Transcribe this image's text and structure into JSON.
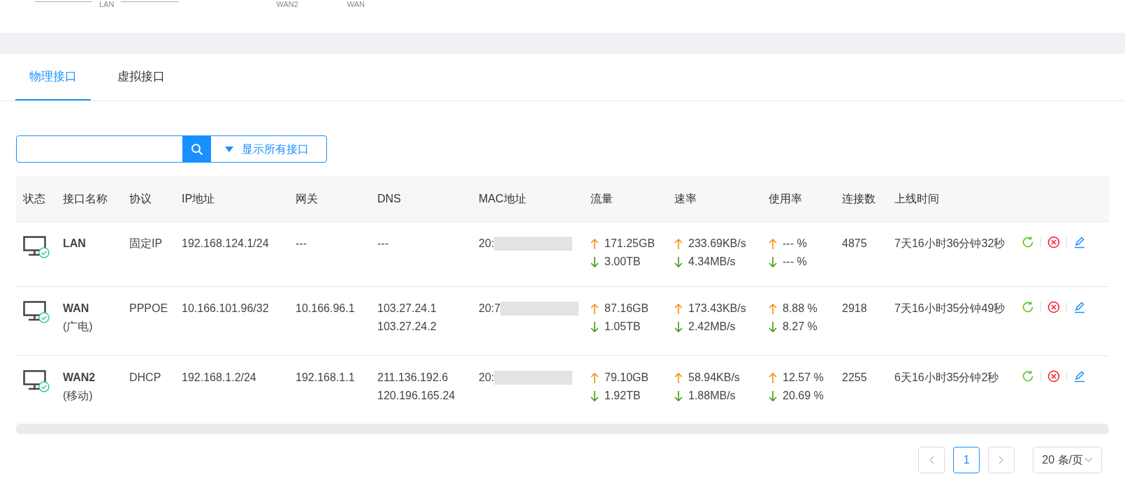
{
  "topology_labels": [
    "LAN",
    "WAN2",
    "WAN"
  ],
  "tabs": [
    {
      "label": "物理接口",
      "selected": true
    },
    {
      "label": "虚拟接口",
      "selected": false
    }
  ],
  "search": {
    "filter_label": "显示所有接口"
  },
  "table": {
    "columns": [
      "状态",
      "接口名称",
      "协议",
      "IP地址",
      "网关",
      "DNS",
      "MAC地址",
      "流量",
      "速率",
      "使用率",
      "连接数",
      "上线时间"
    ],
    "rows": [
      {
        "online": true,
        "name": "LAN",
        "isp": null,
        "protocol": "固定IP",
        "ip": "192.168.124.1/24",
        "gateway": "---",
        "dns": [
          "---"
        ],
        "mac": "20:",
        "traffic": [
          "171.25GB",
          "3.00TB"
        ],
        "rate": [
          "233.69KB/s",
          "4.34MB/s"
        ],
        "usage": [
          "--- %",
          "--- %"
        ],
        "connections": "4875",
        "uptime": "7天16小时36分钟32秒"
      },
      {
        "online": true,
        "name": "WAN",
        "isp": "(广电)",
        "protocol": "PPPOE",
        "ip": "10.166.101.96/32",
        "gateway": "10.166.96.1",
        "dns": [
          "103.27.24.1",
          "103.27.24.2"
        ],
        "mac": "20:7",
        "traffic": [
          "87.16GB",
          "1.05TB"
        ],
        "rate": [
          "173.43KB/s",
          "2.42MB/s"
        ],
        "usage": [
          "8.88 %",
          "8.27 %"
        ],
        "connections": "2918",
        "uptime": "7天16小时35分钟49秒"
      },
      {
        "online": true,
        "name": "WAN2",
        "isp": "(移动)",
        "protocol": "DHCP",
        "ip": "192.168.1.2/24",
        "gateway": "192.168.1.1",
        "dns": [
          "211.136.192.6",
          "120.196.165.24"
        ],
        "mac": "20:",
        "traffic": [
          "79.10GB",
          "1.92TB"
        ],
        "rate": [
          "58.94KB/s",
          "1.88MB/s"
        ],
        "usage": [
          "12.57 %",
          "20.69 %"
        ],
        "connections": "2255",
        "uptime": "6天16小时35分钟2秒"
      }
    ]
  },
  "pagination": {
    "current": "1",
    "page_size": "20 条/页"
  }
}
